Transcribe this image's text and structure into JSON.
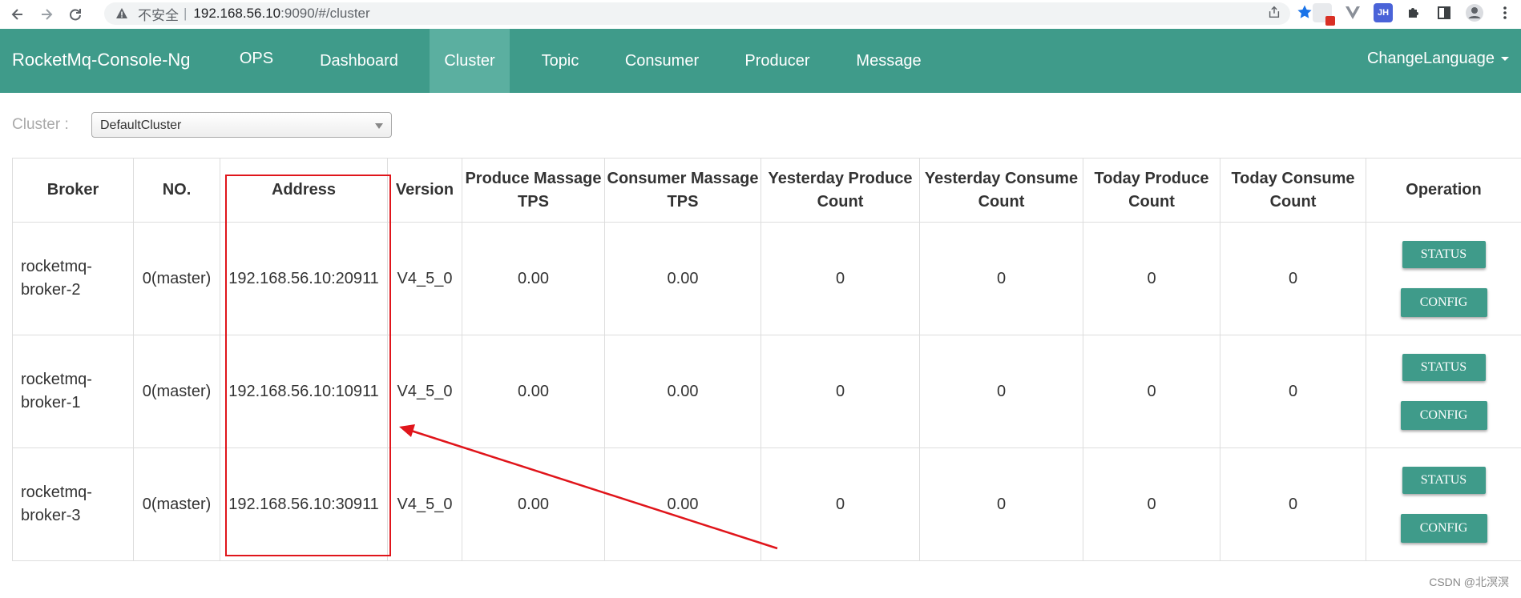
{
  "browser": {
    "insecure_label": "不安全",
    "separator": "|",
    "url_host": "192.168.56.10",
    "url_path": ":9090/#/cluster",
    "ext_jh_label": "JH"
  },
  "header": {
    "brand": "RocketMq-Console-Ng",
    "nav": [
      {
        "label": "OPS"
      },
      {
        "label": "Dashboard"
      },
      {
        "label": "Cluster"
      },
      {
        "label": "Topic"
      },
      {
        "label": "Consumer"
      },
      {
        "label": "Producer"
      },
      {
        "label": "Message"
      }
    ],
    "active_nav": "Cluster",
    "language_label": "ChangeLanguage"
  },
  "cluster": {
    "label": "Cluster :",
    "selected": "DefaultCluster"
  },
  "table": {
    "columns": [
      "Broker",
      "NO.",
      "Address",
      "Version",
      "Produce Massage TPS",
      "Consumer Massage TPS",
      "Yesterday Produce Count",
      "Yesterday Consume Count",
      "Today Produce Count",
      "Today Consume Count",
      "Operation"
    ],
    "rows": [
      {
        "broker": "rocketmq-broker-2",
        "no": "0(master)",
        "address": "192.168.56.10:20911",
        "version": "V4_5_0",
        "produce_tps": "0.00",
        "consume_tps": "0.00",
        "yesterday_produce": "0",
        "yesterday_consume": "0",
        "today_produce": "0",
        "today_consume": "0"
      },
      {
        "broker": "rocketmq-broker-1",
        "no": "0(master)",
        "address": "192.168.56.10:10911",
        "version": "V4_5_0",
        "produce_tps": "0.00",
        "consume_tps": "0.00",
        "yesterday_produce": "0",
        "yesterday_consume": "0",
        "today_produce": "0",
        "today_consume": "0"
      },
      {
        "broker": "rocketmq-broker-3",
        "no": "0(master)",
        "address": "192.168.56.10:30911",
        "version": "V4_5_0",
        "produce_tps": "0.00",
        "consume_tps": "0.00",
        "yesterday_produce": "0",
        "yesterday_consume": "0",
        "today_produce": "0",
        "today_consume": "0"
      }
    ],
    "status_label": "STATUS",
    "config_label": "CONFIG"
  },
  "annotation": {
    "color": "#e0151b"
  },
  "colors": {
    "header": "#3f9b8a",
    "active_nav": "#5bafa0",
    "button": "#3f9b8a"
  },
  "watermark": "CSDN @北溟溟"
}
